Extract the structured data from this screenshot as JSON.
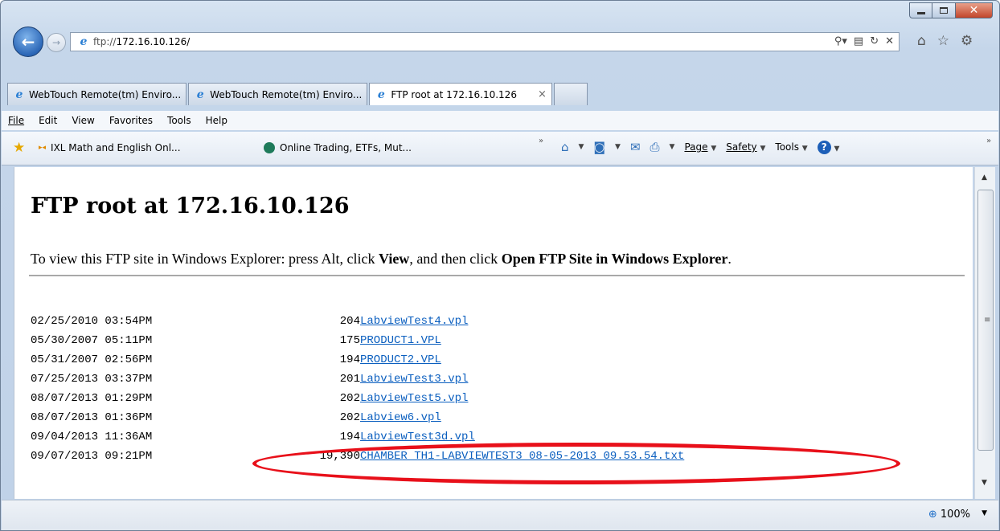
{
  "address": {
    "scheme": "ftp://",
    "host": "172.16.10.126/"
  },
  "tabs": [
    {
      "label": "WebTouch Remote(tm) Enviro...",
      "active": false
    },
    {
      "label": "WebTouch Remote(tm) Enviro...",
      "active": false
    },
    {
      "label": "FTP root at 172.16.10.126",
      "active": true,
      "close": "×"
    }
  ],
  "menu": [
    {
      "label": "File"
    },
    {
      "label": "Edit"
    },
    {
      "label": "View"
    },
    {
      "label": "Favorites"
    },
    {
      "label": "Tools"
    },
    {
      "label": "Help"
    }
  ],
  "favorites": [
    {
      "label": "IXL Math and English  Onl..."
    },
    {
      "label": "Online Trading, ETFs, Mut..."
    }
  ],
  "command_bar": {
    "page": "Page",
    "safety": "Safety",
    "tools": "Tools"
  },
  "page": {
    "title": "FTP root at 172.16.10.126",
    "intro_1": "To view this FTP site in Windows Explorer: press Alt, click ",
    "intro_view": "View",
    "intro_2": ", and then click ",
    "intro_open": "Open FTP Site in Windows Explorer",
    "intro_3": "."
  },
  "listing": [
    {
      "date": "02/25/2010 03:54PM",
      "size": "204",
      "name": "LabviewTest4.vpl"
    },
    {
      "date": "05/30/2007 05:11PM",
      "size": "175",
      "name": "PRODUCT1.VPL"
    },
    {
      "date": "05/31/2007 02:56PM",
      "size": "194",
      "name": "PRODUCT2.VPL"
    },
    {
      "date": "07/25/2013 03:37PM",
      "size": "201",
      "name": "LabviewTest3.vpl"
    },
    {
      "date": "08/07/2013 01:29PM",
      "size": "202",
      "name": "LabviewTest5.vpl"
    },
    {
      "date": "08/07/2013 01:36PM",
      "size": "202",
      "name": "Labview6.vpl"
    },
    {
      "date": "09/04/2013 11:36AM",
      "size": "194",
      "name": "LabviewTest3d.vpl"
    },
    {
      "date": "09/07/2013 09:21PM",
      "size": "19,390",
      "name": "CHAMBER TH1-LABVIEWTEST3 08-05-2013 09.53.54.txt"
    }
  ],
  "status": {
    "zoom": "100%"
  },
  "colors": {
    "link": "#0b5fbf",
    "highlight": "#e8101a"
  }
}
